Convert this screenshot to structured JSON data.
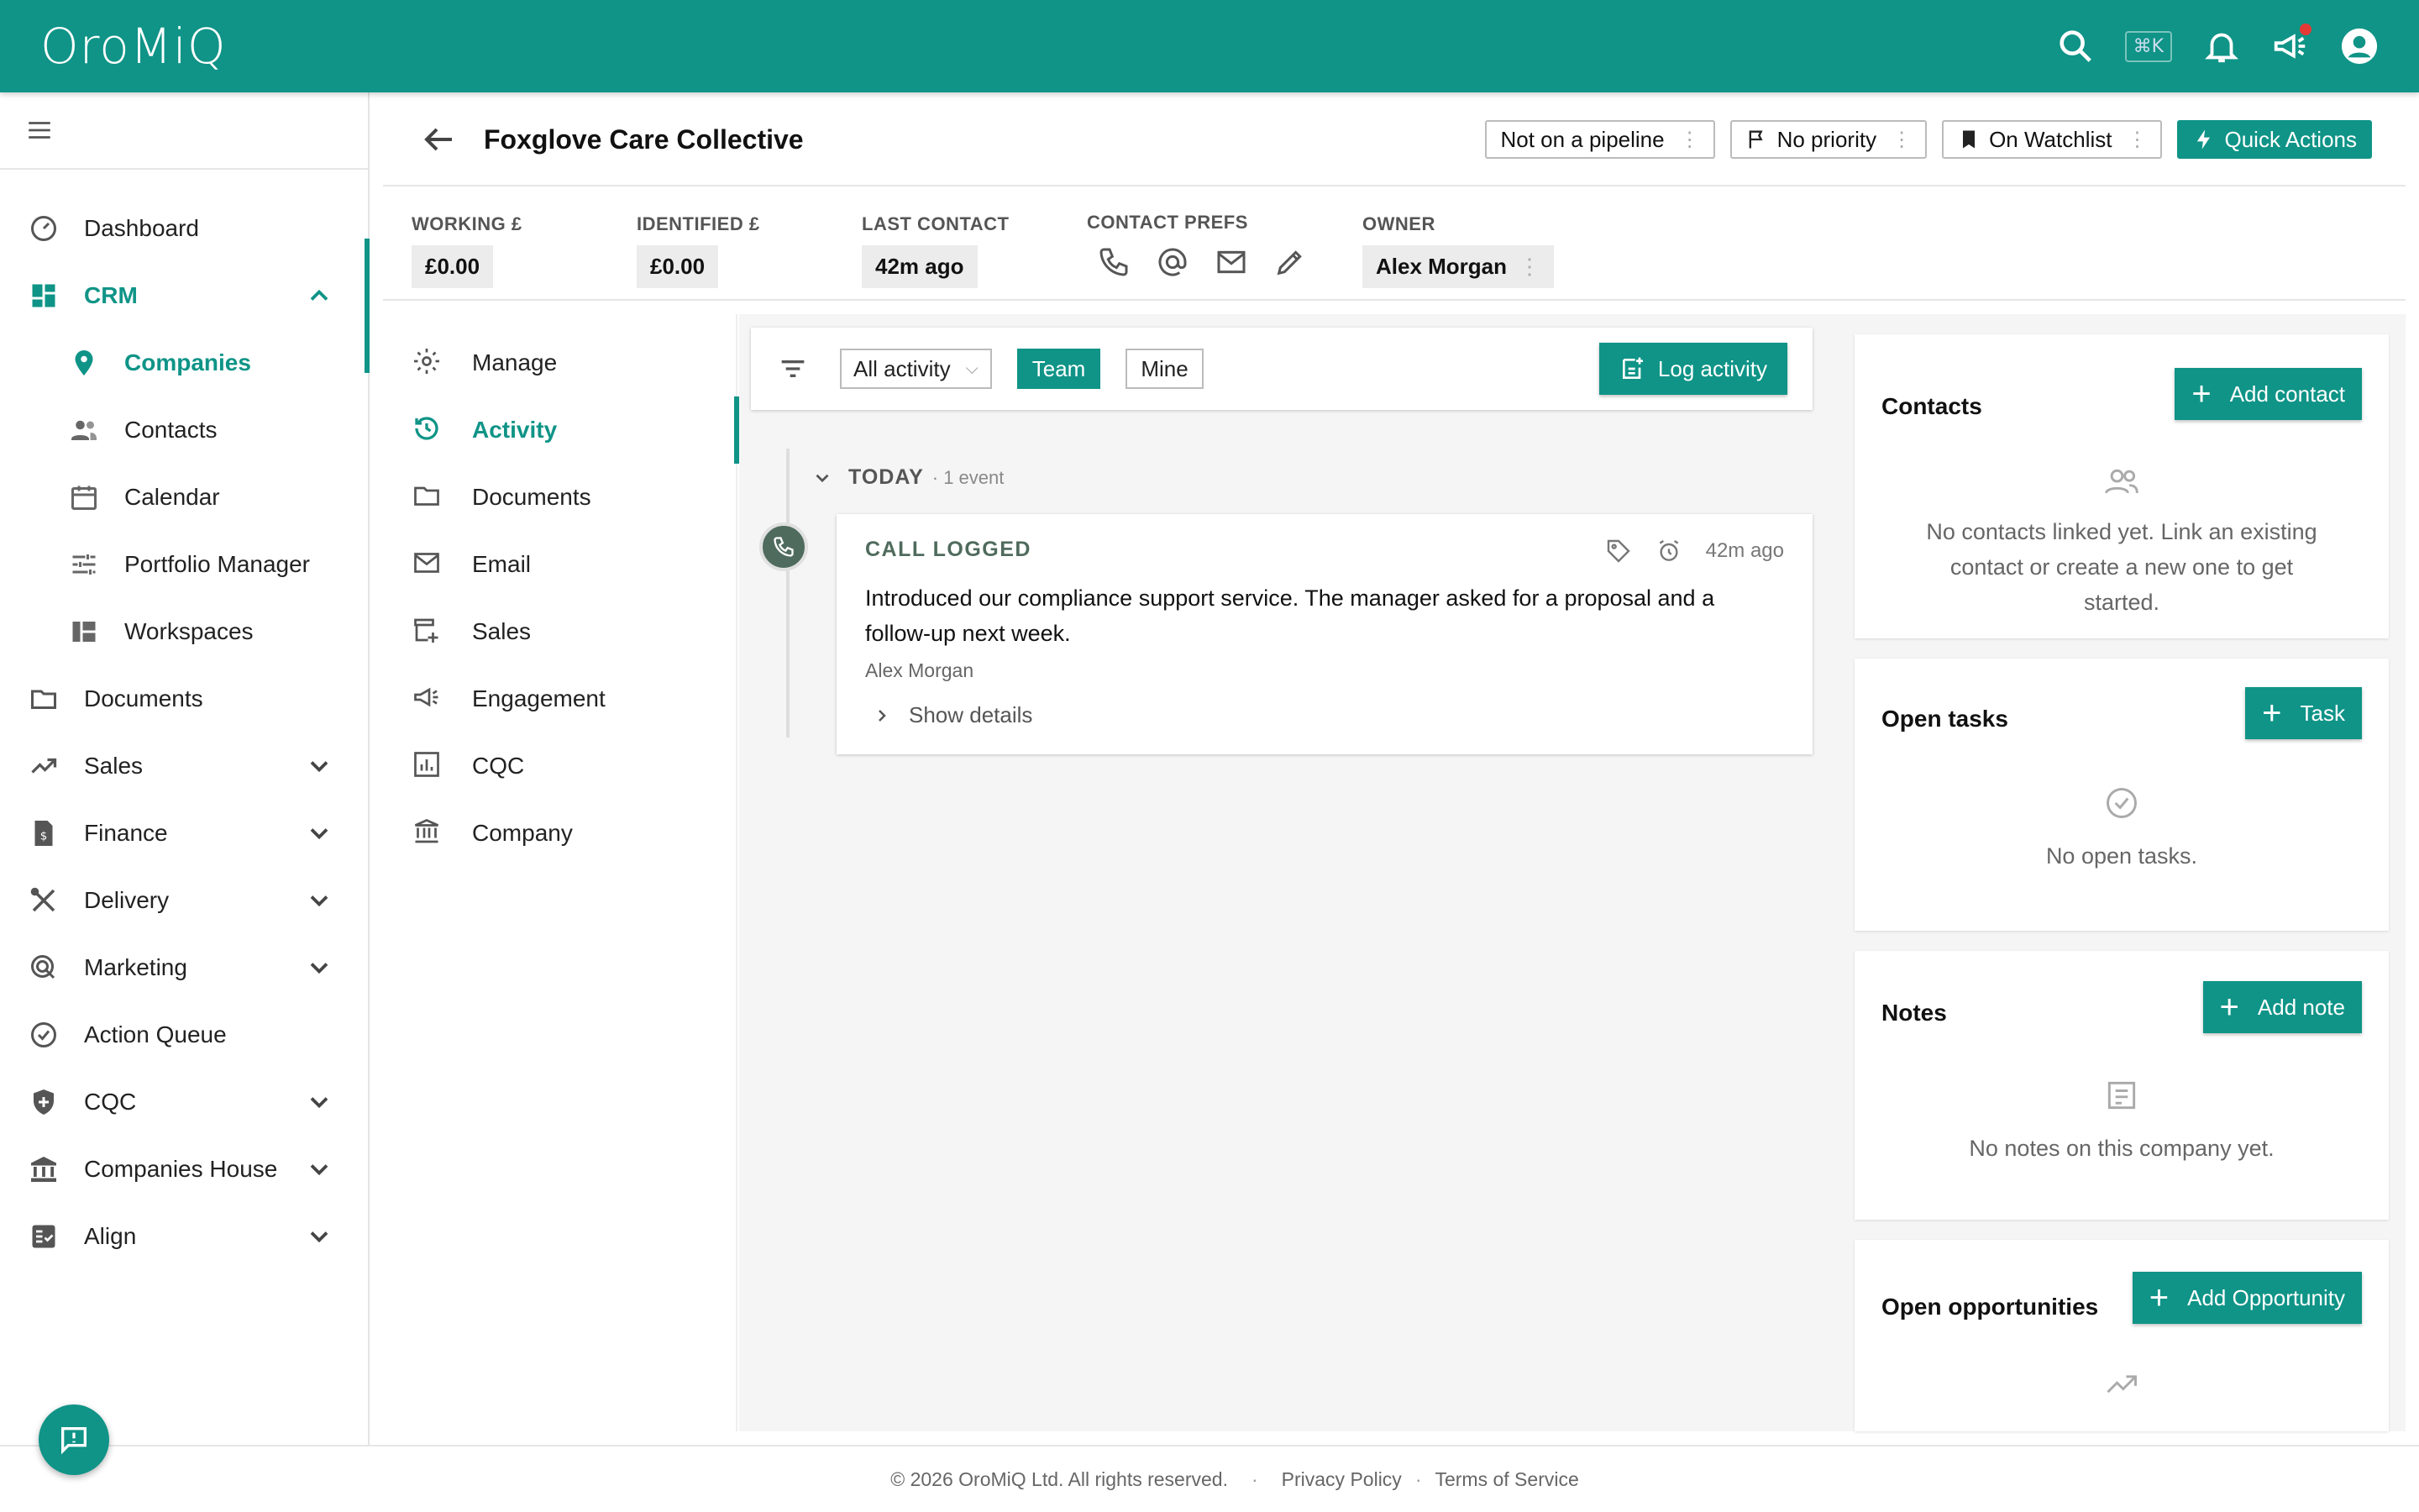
{
  "app": {
    "logo": "OroMiQ",
    "shortcut": "⌘K"
  },
  "sidebar": {
    "items": [
      {
        "label": "Dashboard"
      },
      {
        "label": "CRM"
      },
      {
        "label": "Companies"
      },
      {
        "label": "Contacts"
      },
      {
        "label": "Calendar"
      },
      {
        "label": "Portfolio Manager"
      },
      {
        "label": "Workspaces"
      },
      {
        "label": "Documents"
      },
      {
        "label": "Sales"
      },
      {
        "label": "Finance"
      },
      {
        "label": "Delivery"
      },
      {
        "label": "Marketing"
      },
      {
        "label": "Action Queue"
      },
      {
        "label": "CQC"
      },
      {
        "label": "Companies House"
      },
      {
        "label": "Align"
      }
    ]
  },
  "header": {
    "title": "Foxglove Care Collective",
    "pipeline": "Not on a pipeline",
    "priority": "No priority",
    "watchlist": "On Watchlist",
    "quick_actions": "Quick Actions"
  },
  "stats": {
    "working_label": "WORKING £",
    "working_value": "£0.00",
    "identified_label": "IDENTIFIED £",
    "identified_value": "£0.00",
    "last_contact_label": "LAST CONTACT",
    "last_contact_value": "42m ago",
    "prefs_label": "CONTACT PREFS",
    "owner_label": "OWNER",
    "owner_value": "Alex Morgan"
  },
  "subnav": {
    "items": [
      {
        "label": "Manage"
      },
      {
        "label": "Activity"
      },
      {
        "label": "Documents"
      },
      {
        "label": "Email"
      },
      {
        "label": "Sales"
      },
      {
        "label": "Engagement"
      },
      {
        "label": "CQC"
      },
      {
        "label": "Company"
      }
    ]
  },
  "activity": {
    "filter_value": "All activity",
    "team": "Team",
    "mine": "Mine",
    "log_button": "Log activity",
    "group_label": "TODAY",
    "group_count": "· 1 event",
    "event": {
      "type": "CALL LOGGED",
      "time": "42m ago",
      "body": "Introduced our compliance support service. The manager asked for a proposal and a follow-up next week.",
      "author": "Alex Morgan",
      "details": "Show details"
    }
  },
  "right": {
    "contacts": {
      "title": "Contacts",
      "button": "Add contact",
      "empty": "No contacts linked yet. Link an existing contact or create a new one to get started."
    },
    "tasks": {
      "title": "Open tasks",
      "button": "Task",
      "empty": "No open tasks."
    },
    "notes": {
      "title": "Notes",
      "button": "Add note",
      "empty": "No notes on this company yet."
    },
    "opportunities": {
      "title": "Open opportunities",
      "button": "Add Opportunity"
    }
  },
  "footer": {
    "copyright": "© 2026 OroMiQ Ltd. All rights reserved.",
    "privacy": "Privacy Policy",
    "terms": "Terms of Service"
  },
  "colors": {
    "accent": "#0f9487",
    "event": "#4f6b5d",
    "alert": "#e53935"
  }
}
